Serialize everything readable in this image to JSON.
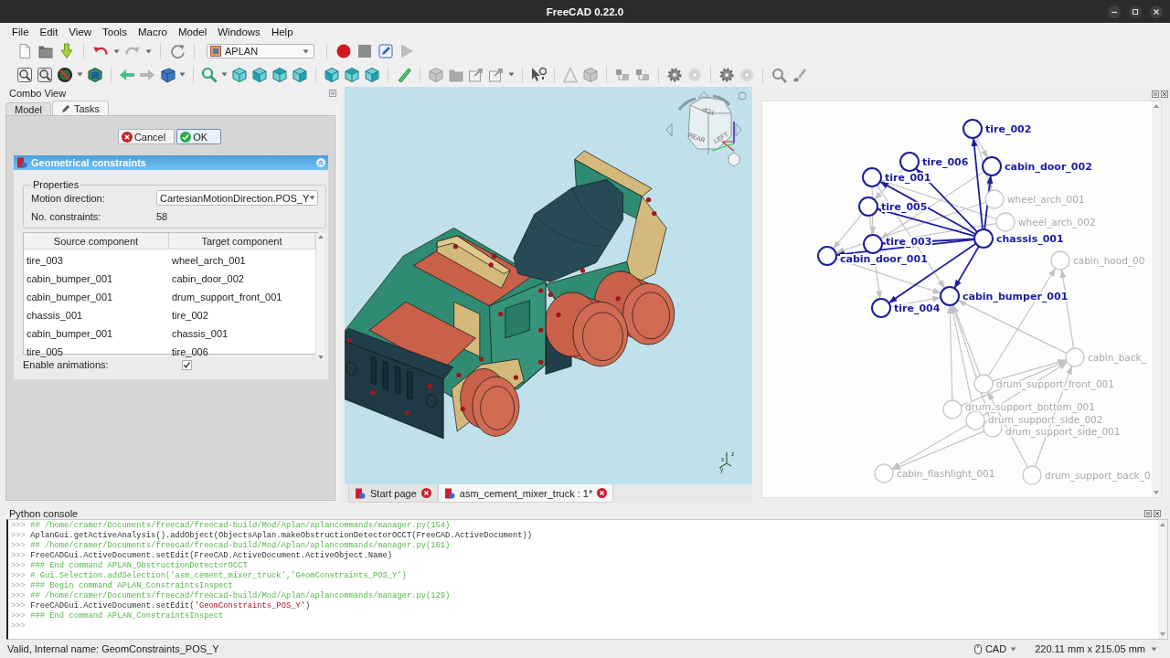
{
  "window": {
    "title": "FreeCAD 0.22.0"
  },
  "menu": [
    "File",
    "Edit",
    "View",
    "Tools",
    "Macro",
    "Model",
    "Windows",
    "Help"
  ],
  "toolbar": {
    "workbench": "APLAN"
  },
  "combo_view": {
    "title": "Combo View",
    "tabs": [
      {
        "label": "Model",
        "selected": false
      },
      {
        "label": "Tasks",
        "selected": true
      }
    ],
    "buttons": [
      {
        "label": "Cancel",
        "kind": "cancel"
      },
      {
        "label": "OK",
        "kind": "ok"
      }
    ],
    "panel": {
      "title": "Geometrical constraints",
      "group": "Properties",
      "fields": [
        {
          "label": "Motion direction:",
          "kind": "dropdown",
          "value": "CartesianMotionDirection.POS_Y"
        },
        {
          "label": "No. constraints:",
          "kind": "text",
          "value": "58"
        }
      ],
      "table": {
        "columns": [
          "Source component",
          "Target component"
        ],
        "rows": [
          [
            "tire_003",
            "wheel_arch_001"
          ],
          [
            "cabin_bumper_001",
            "cabin_door_002"
          ],
          [
            "cabin_bumper_001",
            "drum_support_front_001"
          ],
          [
            "chassis_001",
            "tire_002"
          ],
          [
            "cabin_bumper_001",
            "chassis_001"
          ],
          [
            "tire_005",
            "tire_006"
          ]
        ]
      },
      "checkbox": {
        "label": "Enable animations:",
        "checked": true
      }
    }
  },
  "view3d": {
    "nav_cube": [
      "TOP",
      "REAR",
      "LEFT"
    ],
    "axis_labels": [
      "z",
      "x",
      "y"
    ]
  },
  "graph": {
    "nodes": [
      {
        "label": "tire_002",
        "highlighted": true
      },
      {
        "label": "tire_006",
        "highlighted": true
      },
      {
        "label": "cabin_door_002",
        "highlighted": true
      },
      {
        "label": "tire_001",
        "highlighted": true
      },
      {
        "label": "tire_005",
        "highlighted": true
      },
      {
        "label": "wheel_arch_001",
        "highlighted": false
      },
      {
        "label": "wheel_arch_002",
        "highlighted": false
      },
      {
        "label": "tire_003",
        "highlighted": true
      },
      {
        "label": "chassis_001",
        "highlighted": true
      },
      {
        "label": "cabin_door_001",
        "highlighted": true
      },
      {
        "label": "cabin_hood_00",
        "highlighted": false
      },
      {
        "label": "cabin_bumper_001",
        "highlighted": true
      },
      {
        "label": "tire_004",
        "highlighted": true
      },
      {
        "label": "cabin_back_",
        "highlighted": false
      },
      {
        "label": "drum_support_front_001",
        "highlighted": false
      },
      {
        "label": "drum_support_bottom_001",
        "highlighted": false
      },
      {
        "label": "drum_support_side_002",
        "highlighted": false
      },
      {
        "label": "drum_support_side_001",
        "highlighted": false
      },
      {
        "label": "cabin_flashlight_001",
        "highlighted": false
      },
      {
        "label": "drum_support_back_0",
        "highlighted": false
      }
    ]
  },
  "document_tabs": [
    {
      "label": "Start page",
      "selected": false
    },
    {
      "label": "asm_cement_mixer_truck : 1*",
      "selected": true
    }
  ],
  "console": {
    "title": "Python console",
    "lines": [
      {
        "prompt": ">>>",
        "segments": [
          {
            "kind": "comment",
            "text": "## /home/cramer/Documents/freecad/freecad-build/Mod/Aplan/aplancommands/manager.py(154)"
          }
        ]
      },
      {
        "prompt": ">>>",
        "segments": [
          {
            "kind": "code",
            "text": "AplanGui.getActiveAnalysis().addObject(ObjectsAplan.makeObstructionDetectorOCCT(FreeCAD.ActiveDocument))"
          }
        ]
      },
      {
        "prompt": ">>>",
        "segments": [
          {
            "kind": "comment",
            "text": "## /home/cramer/Documents/freecad/freecad-build/Mod/Aplan/aplancommands/manager.py(161)"
          }
        ]
      },
      {
        "prompt": ">>>",
        "segments": [
          {
            "kind": "code",
            "text": "FreeCADGui.ActiveDocument.setEdit(FreeCAD.ActiveDocument.ActiveObject.Name)"
          }
        ]
      },
      {
        "prompt": ">>>",
        "segments": [
          {
            "kind": "comment",
            "text": "### End command APLAN_ObstructionDetectorOCCT"
          }
        ]
      },
      {
        "prompt": ">>>",
        "segments": [
          {
            "kind": "comment",
            "text": "# Gui.Selection.addSelection('asm_cement_mixer_truck','GeomConstraints_POS_Y')"
          }
        ]
      },
      {
        "prompt": ">>>",
        "segments": [
          {
            "kind": "comment",
            "text": "### Begin command APLAN_ConstraintsInspect"
          }
        ]
      },
      {
        "prompt": ">>>",
        "segments": [
          {
            "kind": "comment",
            "text": "## /home/cramer/Documents/freecad/freecad-build/Mod/Aplan/aplancommands/manager.py(129)"
          }
        ]
      },
      {
        "prompt": ">>>",
        "segments": [
          {
            "kind": "code",
            "text": "FreeCADGui.ActiveDocument.setEdit("
          },
          {
            "kind": "string",
            "text": "'GeomConstraints_POS_Y'"
          },
          {
            "kind": "code",
            "text": ")"
          }
        ]
      },
      {
        "prompt": ">>>",
        "segments": [
          {
            "kind": "comment",
            "text": "### End command APLAN_ConstraintsInspect"
          }
        ]
      },
      {
        "prompt": ">>>"
      }
    ]
  },
  "status_bar": {
    "message": "Valid, Internal name: GeomConstraints_POS_Y",
    "navigation": "CAD",
    "dimensions": "220.11 mm x 215.05 mm"
  }
}
